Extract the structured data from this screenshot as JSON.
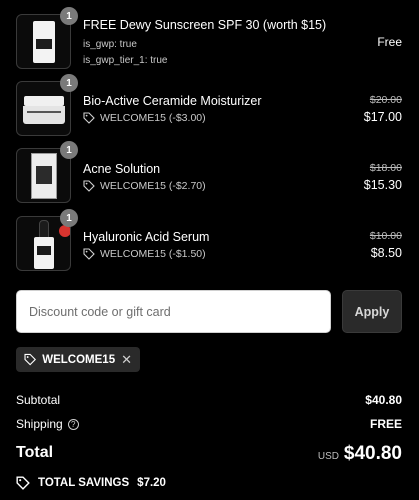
{
  "items": [
    {
      "title": "FREE Dewy Sunscreen SPF 30 (worth $15)",
      "meta": [
        "is_gwp: true",
        "is_gwp_tier_1: true"
      ],
      "quantity": "1",
      "price": "Free"
    },
    {
      "title": "Bio-Active Ceramide Moisturizer",
      "discount": "WELCOME15 (-$3.00)",
      "quantity": "1",
      "original_price": "$20.00",
      "price": "$17.00"
    },
    {
      "title": "Acne Solution",
      "discount": "WELCOME15 (-$2.70)",
      "quantity": "1",
      "original_price": "$18.00",
      "price": "$15.30"
    },
    {
      "title": "Hyaluronic Acid Serum",
      "discount": "WELCOME15 (-$1.50)",
      "quantity": "1",
      "original_price": "$10.00",
      "price": "$8.50"
    }
  ],
  "discount": {
    "placeholder": "Discount code or gift card",
    "apply_label": "Apply",
    "applied_code": "WELCOME15"
  },
  "summary": {
    "subtotal_label": "Subtotal",
    "subtotal_value": "$40.80",
    "shipping_label": "Shipping",
    "shipping_value": "FREE",
    "total_label": "Total",
    "currency": "USD",
    "total_value": "$40.80",
    "savings_label": "TOTAL SAVINGS",
    "savings_value": "$7.20"
  },
  "icons": {
    "tag": "tag-icon",
    "close": "close-icon",
    "help": "help-circle-icon"
  }
}
